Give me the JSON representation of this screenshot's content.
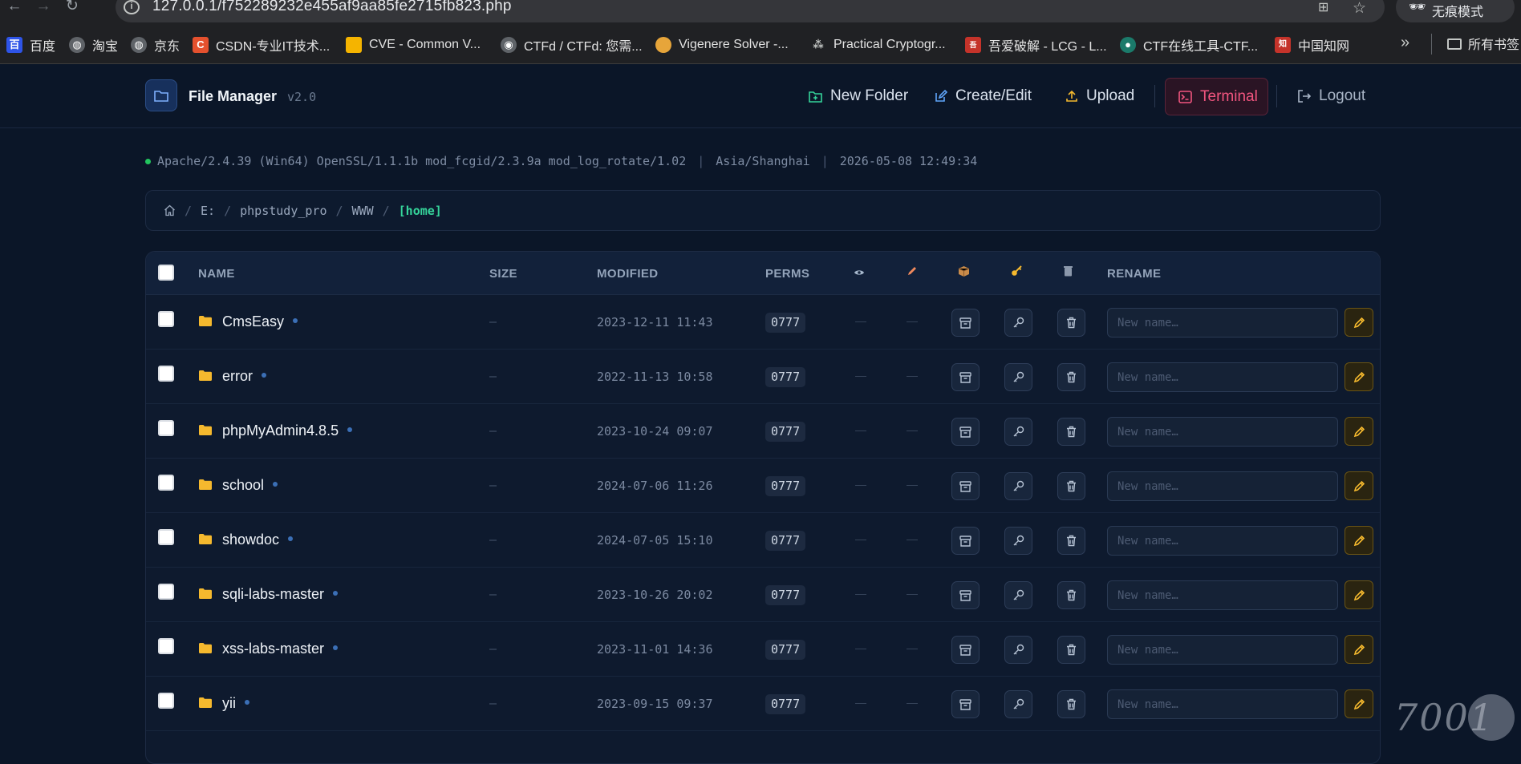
{
  "browser": {
    "url": "127.0.0.1/f752289232e455af9aa85fe2715fb823.php",
    "incognito_label": "无痕模式",
    "bookmarks": [
      {
        "label": "百度",
        "icon": "baidu-icon",
        "color": "#2e54e8"
      },
      {
        "label": "淘宝",
        "icon": "globe-icon",
        "color": "#5f6368"
      },
      {
        "label": "京东",
        "icon": "globe-icon",
        "color": "#5f6368"
      },
      {
        "label": "CSDN-专业IT技术...",
        "icon": "csdn-icon",
        "color": "#e5512e"
      },
      {
        "label": "CVE - Common V...",
        "icon": "cve-icon",
        "color": "#f5b400"
      },
      {
        "label": "CTFd / CTFd: 您需...",
        "icon": "github-icon",
        "color": "#5f6368"
      },
      {
        "label": "Vigenere Solver -...",
        "icon": "vigenere-icon",
        "color": "#e7a53a"
      },
      {
        "label": "Practical Cryptogr...",
        "icon": "crypto-icon",
        "color": "#5f6368"
      },
      {
        "label": "吾爱破解 - LCG - L...",
        "icon": "52pojie-icon",
        "color": "#c5332a"
      },
      {
        "label": "CTF在线工具-CTF...",
        "icon": "ctftool-icon",
        "color": "#1b7a6a"
      },
      {
        "label": "中国知网",
        "icon": "cnki-icon",
        "color": "#c5332a"
      }
    ],
    "bookmarks_more": "»",
    "all_bookmarks_label": "所有书签"
  },
  "header": {
    "title": "File Manager",
    "version": "v2.0",
    "new_folder": "New Folder",
    "create_edit": "Create/Edit",
    "upload": "Upload",
    "terminal": "Terminal",
    "logout": "Logout"
  },
  "info": {
    "server": "Apache/2.4.39 (Win64) OpenSSL/1.1.1b mod_fcgid/2.3.9a mod_log_rotate/1.02",
    "timezone": "Asia/Shanghai",
    "datetime": "2026-05-08 12:49:34"
  },
  "breadcrumb": {
    "parts": [
      "E:",
      "phpstudy_pro",
      "WWW"
    ],
    "current": "[home]"
  },
  "table": {
    "headers": {
      "name": "NAME",
      "size": "SIZE",
      "modified": "MODIFIED",
      "perms": "PERMS",
      "rename": "RENAME"
    },
    "rename_placeholder": "New name…",
    "rows": [
      {
        "name": "CmsEasy",
        "size": "—",
        "modified": "2023-12-11 11:43",
        "perms": "0777"
      },
      {
        "name": "error",
        "size": "—",
        "modified": "2022-11-13 10:58",
        "perms": "0777"
      },
      {
        "name": "phpMyAdmin4.8.5",
        "size": "—",
        "modified": "2023-10-24 09:07",
        "perms": "0777"
      },
      {
        "name": "school",
        "size": "—",
        "modified": "2024-07-06 11:26",
        "perms": "0777"
      },
      {
        "name": "showdoc",
        "size": "—",
        "modified": "2024-07-05 15:10",
        "perms": "0777"
      },
      {
        "name": "sqli-labs-master",
        "size": "—",
        "modified": "2023-10-26 20:02",
        "perms": "0777"
      },
      {
        "name": "xss-labs-master",
        "size": "—",
        "modified": "2023-11-01 14:36",
        "perms": "0777"
      },
      {
        "name": "yii",
        "size": "—",
        "modified": "2023-09-15 09:37",
        "perms": "0777"
      }
    ],
    "empty_cell": "—"
  },
  "colors": {
    "background": "#0b1628",
    "accent_green": "#35d49a",
    "terminal_red": "#f2557f",
    "folder_yellow": "#f5b92e"
  }
}
